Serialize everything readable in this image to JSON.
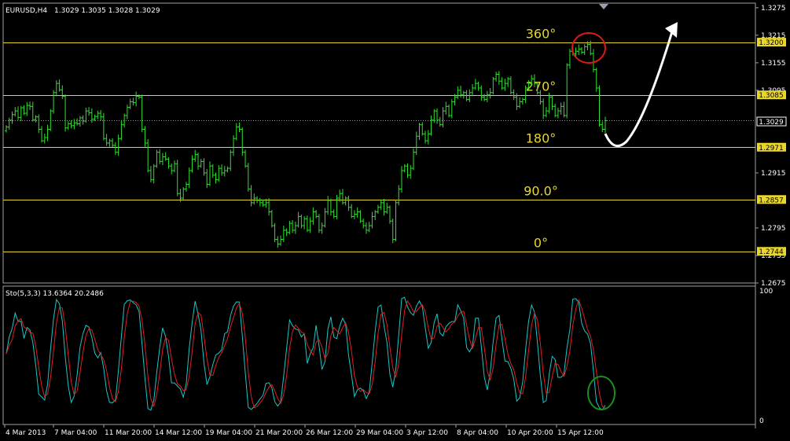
{
  "header": {
    "symbol_timeframe": "EURUSD,H4",
    "ohlc": "1.3029 1.3035 1.3028 1.3029"
  },
  "price_axis": {
    "range": [
      1.2675,
      1.3275
    ],
    "ticks": [
      "1.3275",
      "1.3215",
      "1.3155",
      "1.3095",
      "1.2915",
      "1.2795",
      "1.2735",
      "1.2675"
    ]
  },
  "levels": [
    {
      "price": 1.32,
      "label": "1.3200",
      "angle": "360°",
      "color": "#e9d62b"
    },
    {
      "price": 1.3085,
      "label": "1.3085",
      "angle": "270°",
      "color": "#e9d62b"
    },
    {
      "price": 1.2971,
      "label": "1.2971",
      "angle": "180°",
      "color": "#e9d62b"
    },
    {
      "price": 1.2857,
      "label": "1.2857",
      "angle": "90.0°",
      "color": "#e9d62b"
    },
    {
      "price": 1.2744,
      "label": "1.2744",
      "angle": "0°",
      "color": "#e9d62b"
    }
  ],
  "current_price": {
    "price": 1.3029,
    "label": "1.3029"
  },
  "time_axis": [
    "4 Mar 2013",
    "7 Mar 04:00",
    "11 Mar 20:00",
    "14 Mar 12:00",
    "19 Mar 04:00",
    "21 Mar 20:00",
    "26 Mar 12:00",
    "29 Mar 04:00",
    "3 Apr 12:00",
    "8 Apr 04:00",
    "10 Apr 20:00",
    "15 Apr 12:00"
  ],
  "stochastic": {
    "title": "Sto(5,3,3) 13.6364 20.2486",
    "axis_top": "100",
    "axis_bottom": "0",
    "main_color": "#19c7c7",
    "signal_color": "#e02020"
  },
  "colors": {
    "candles": "#2fe02f",
    "levels": "#e9d62b",
    "grid": "#9a9a9a",
    "annotation_top": "#e01818",
    "annotation_bottom": "#1b8f1b",
    "arrow": "#ffffff"
  },
  "chart_data": {
    "type": "candlestick",
    "series_name": "EURUSD,H4",
    "close": [
      1.3015,
      1.303,
      1.3042,
      1.305,
      1.3036,
      1.3057,
      1.3045,
      1.3062,
      1.306,
      1.3031,
      1.3037,
      1.301,
      1.2985,
      1.2992,
      1.301,
      1.305,
      1.309,
      1.311,
      1.3096,
      1.3082,
      1.3013,
      1.3022,
      1.3018,
      1.3024,
      1.3022,
      1.3035,
      1.3028,
      1.305,
      1.3046,
      1.3032,
      1.3038,
      1.3045,
      1.3037,
      1.299,
      1.298,
      1.2985,
      1.2975,
      1.296,
      1.299,
      1.302,
      1.304,
      1.3058,
      1.307,
      1.3068,
      1.3082,
      1.308,
      1.301,
      1.298,
      1.292,
      1.29,
      1.293,
      1.296,
      1.294,
      1.295,
      1.2945,
      1.293,
      1.292,
      1.2935,
      1.287,
      1.286,
      1.288,
      1.289,
      1.292,
      1.2945,
      1.2955,
      1.293,
      1.294,
      1.2915,
      1.289,
      1.293,
      1.291,
      1.29,
      1.2925,
      1.2915,
      1.292,
      1.2925,
      1.296,
      1.299,
      1.3015,
      1.301,
      1.296,
      1.293,
      1.288,
      1.285,
      1.286,
      1.2855,
      1.285,
      1.2845,
      1.285,
      1.283,
      1.28,
      1.277,
      1.276,
      1.277,
      1.279,
      1.2785,
      1.2805,
      1.279,
      1.28,
      1.282,
      1.28,
      1.2815,
      1.279,
      1.281,
      1.283,
      1.282,
      1.279,
      1.28,
      1.283,
      1.2855,
      1.283,
      1.282,
      1.286,
      1.287,
      1.285,
      1.286,
      1.284,
      1.282,
      1.2825,
      1.283,
      1.281,
      1.28,
      1.279,
      1.28,
      1.282,
      1.283,
      1.284,
      1.285,
      1.283,
      1.284,
      1.281,
      1.277,
      1.285,
      1.288,
      1.292,
      1.293,
      1.291,
      1.2925,
      1.296,
      1.2995,
      1.302,
      1.3,
      1.2985,
      1.3,
      1.303,
      1.305,
      1.303,
      1.302,
      1.305,
      1.306,
      1.304,
      1.307,
      1.308,
      1.3095,
      1.3085,
      1.309,
      1.3075,
      1.309,
      1.31,
      1.311,
      1.31,
      1.308,
      1.3075,
      1.3085,
      1.309,
      1.312,
      1.313,
      1.3115,
      1.31,
      1.311,
      1.312,
      1.309,
      1.308,
      1.306,
      1.307,
      1.3075,
      1.31,
      1.311,
      1.312,
      1.311,
      1.309,
      1.307,
      1.304,
      1.305,
      1.308,
      1.306,
      1.304,
      1.305,
      1.306,
      1.304,
      1.315,
      1.318,
      1.3175,
      1.318,
      1.3185,
      1.3178,
      1.319,
      1.3195,
      1.3175,
      1.314,
      1.31,
      1.302,
      1.301,
      1.3029
    ]
  }
}
